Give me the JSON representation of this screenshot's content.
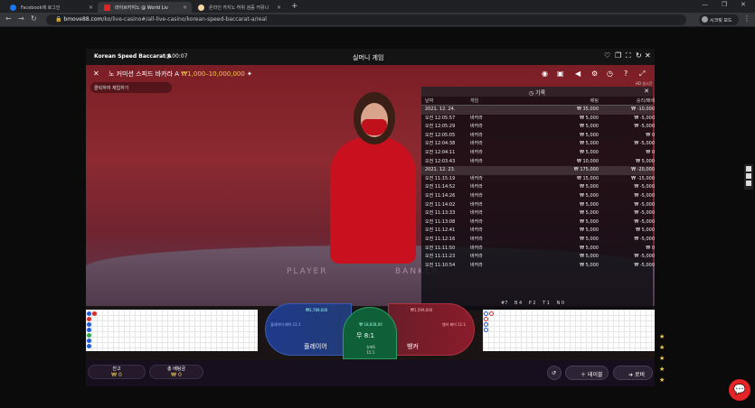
{
  "browser": {
    "tabs": [
      {
        "title": "Facebook에 로그인",
        "favicon_color": "#1877f2"
      },
      {
        "title": "라이브카지노 @ World Liv",
        "favicon_color": "#e02424"
      },
      {
        "title": "온라인 카지노 허위 검증 커뮤니",
        "favicon_color": "#f5d7a1"
      }
    ],
    "url": {
      "domain": "bmove88.com",
      "path": "/ko/live-casino#/all-live-casino/korean-speed-baccarat-a/real"
    },
    "profile": "시크릿 모드"
  },
  "game": {
    "table_name": "Korean Speed Baccarat A",
    "timer": "00:07",
    "mode": "실머니 게임",
    "title": "노 커미션 스피드 바카라 A",
    "limits": "₩1,000–10,000,000",
    "repeat_hint": "클릭하여 재입하기",
    "video_meta": "HD 실시간"
  },
  "history": {
    "title": "기록",
    "headers": [
      "날짜",
      "게임",
      "베팅",
      "승리/패배"
    ],
    "rows": [
      {
        "date": "2021. 12. 24.",
        "game": "",
        "bet": "₩ 35,000",
        "result": "₩ -10,000",
        "is_date": true
      },
      {
        "date": "오전 12:05:57",
        "game": "바카라",
        "bet": "₩ 5,000",
        "result": "₩ -5,000"
      },
      {
        "date": "오전 12:05:29",
        "game": "바카라",
        "bet": "₩ 5,000",
        "result": "₩ -5,000"
      },
      {
        "date": "오전 12:05:05",
        "game": "바카라",
        "bet": "₩ 5,000",
        "result": "₩ 0"
      },
      {
        "date": "오전 12:04:38",
        "game": "바카라",
        "bet": "₩ 5,000",
        "result": "₩ -5,000"
      },
      {
        "date": "오전 12:04:11",
        "game": "바카라",
        "bet": "₩ 5,000",
        "result": "₩ 0"
      },
      {
        "date": "오전 12:03:43",
        "game": "바카라",
        "bet": "₩ 10,000",
        "result": "₩ 5,000"
      },
      {
        "date": "2021. 12. 23.",
        "game": "",
        "bet": "₩ 175,000",
        "result": "₩ -20,000",
        "is_date": true
      },
      {
        "date": "오전 11:15:19",
        "game": "바카라",
        "bet": "₩ 15,000",
        "result": "₩ -15,000"
      },
      {
        "date": "오전 11:14:52",
        "game": "바카라",
        "bet": "₩ 5,000",
        "result": "₩ -5,000"
      },
      {
        "date": "오전 11:14:26",
        "game": "바카라",
        "bet": "₩ 5,000",
        "result": "₩ -5,000"
      },
      {
        "date": "오전 11:14:02",
        "game": "바카라",
        "bet": "₩ 5,000",
        "result": "₩ -5,000"
      },
      {
        "date": "오전 11:13:33",
        "game": "바카라",
        "bet": "₩ 5,000",
        "result": "₩ -5,000"
      },
      {
        "date": "오전 11:13:08",
        "game": "바카라",
        "bet": "₩ 5,000",
        "result": "₩ -5,000"
      },
      {
        "date": "오전 11:12:41",
        "game": "바카라",
        "bet": "₩ 5,000",
        "result": "₩ 5,000"
      },
      {
        "date": "오전 11:12:16",
        "game": "바카라",
        "bet": "₩ 5,000",
        "result": "₩ -5,000"
      },
      {
        "date": "오전 11:11:50",
        "game": "바카라",
        "bet": "₩ 5,000",
        "result": "₩ 0"
      },
      {
        "date": "오전 11:11:23",
        "game": "바카라",
        "bet": "₩ 5,000",
        "result": "₩ -5,000"
      },
      {
        "date": "오전 11:10:54",
        "game": "바카라",
        "bet": "₩ 5,000",
        "result": "₩ -5,000"
      }
    ]
  },
  "betting": {
    "player_label": "플레이어",
    "banker_label": "뱅커",
    "tie_label": "무",
    "tie_payout": "8:1",
    "player_pair": "플레이어 페어 11:1",
    "banker_pair": "뱅커 페어 11:1",
    "player_total": "₩2,789,000",
    "banker_total": "₩1,599,000",
    "tie_total": "₩ 18,828,00",
    "super6": "슈퍼6",
    "super6_payout": "15:1"
  },
  "stats": [
    "#7",
    "B 4",
    "P 2",
    "T 1",
    "N 0"
  ],
  "bottom": {
    "balance_label": "잔고",
    "balance": "₩ 0",
    "total_bet_label": "총 베팅금",
    "total_bet": "₩ 0",
    "table_button": "테이블",
    "lobby_button": "로비",
    "undo_badge": "0"
  }
}
